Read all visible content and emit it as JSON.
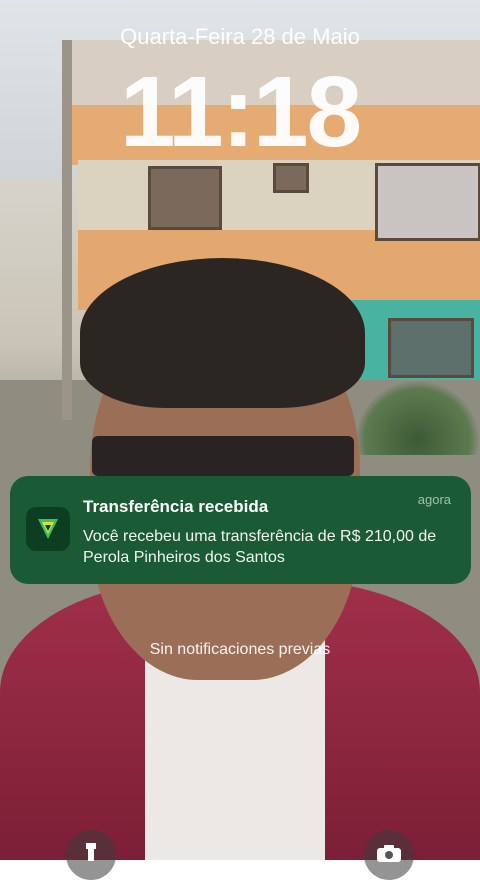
{
  "lockscreen": {
    "date": "Quarta-Feira 28 de Maio",
    "time": "11:18",
    "no_previous_notifications": "Sin notificaciones previas"
  },
  "notification": {
    "app_icon": "bank-logo-icon",
    "title": "Transferência recebida",
    "time": "agora",
    "body": "Você recebeu uma transferência de R$ 210,00 de Perola Pinheiros dos Santos"
  },
  "quick_actions": {
    "left_icon": "flashlight-icon",
    "right_icon": "camera-icon"
  },
  "colors": {
    "notification_bg": "#1a5a35",
    "app_icon_bg": "#0e3e22",
    "logo_green": "#3fbf5e",
    "logo_yellow": "#d8e23a"
  }
}
